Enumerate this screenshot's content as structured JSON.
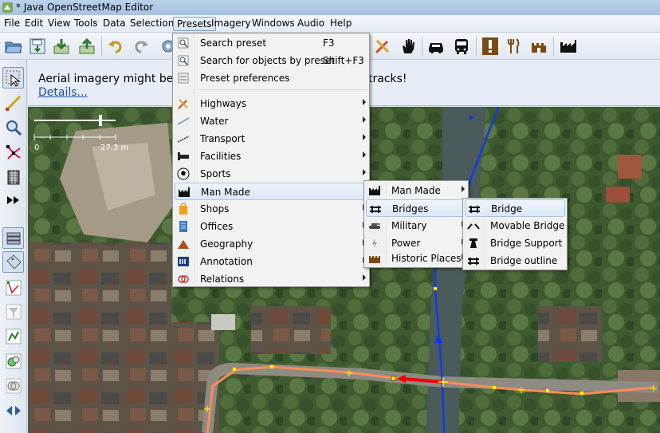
{
  "window": {
    "title": "* Java OpenStreetMap Editor",
    "icon": "josm-logo-icon"
  },
  "menubar": [
    "File",
    "Edit",
    "View",
    "Tools",
    "Data",
    "Selection",
    "Presets",
    "Imagery",
    "Windows",
    "Audio",
    "Help"
  ],
  "active_menu": "Presets",
  "toolbar": {
    "left_icons": [
      "open-folder-icon",
      "save-icon",
      "download-icon",
      "upload-icon",
      "undo-icon",
      "redo-icon",
      "preferences-icon"
    ],
    "right_icons": [
      "highway-tools-icon",
      "hand-icon",
      "car-icon",
      "bus-icon",
      "exclamation-icon",
      "restaurant-icon",
      "castle-icon",
      "factory-icon"
    ]
  },
  "left_toolbar": [
    "select-mode-icon",
    "draw-mode-icon",
    "zoom-mode-icon",
    "node-icon",
    "building-icon",
    "fast-forward-icon",
    "layers-icon",
    "tag-icon",
    "relation-icon",
    "filter-icon",
    "history-icon",
    "conflict-icon",
    "validation-icon",
    "split-icon"
  ],
  "notice": {
    "message_left": "Aerial imagery might be misa",
    "message_right": "tracks!",
    "link": "Details..."
  },
  "map": {
    "scale_start": "0",
    "scale_end": "27.3 m"
  },
  "presets_menu": {
    "top_items": [
      {
        "label": "Search preset",
        "shortcut": "F3",
        "icon": "search-preset-icon"
      },
      {
        "label": "Search for objects by preset",
        "shortcut": "Shift+F3",
        "icon": "search-objects-icon"
      },
      {
        "label": "Preset preferences",
        "shortcut": "",
        "icon": "preset-preferences-icon"
      }
    ],
    "groups": [
      {
        "label": "Highways",
        "icon": "highways-icon"
      },
      {
        "label": "Water",
        "icon": "water-icon"
      },
      {
        "label": "Transport",
        "icon": "transport-icon"
      },
      {
        "label": "Facilities",
        "icon": "facilities-icon"
      },
      {
        "label": "Sports",
        "icon": "sports-icon"
      },
      {
        "label": "Man Made",
        "icon": "man-made-icon"
      },
      {
        "label": "Shops",
        "icon": "shops-icon"
      },
      {
        "label": "Offices",
        "icon": "offices-icon"
      },
      {
        "label": "Geography",
        "icon": "geography-icon"
      },
      {
        "label": "Annotation",
        "icon": "annotation-icon"
      },
      {
        "label": "Relations",
        "icon": "relations-icon"
      }
    ],
    "highlighted": "Man Made"
  },
  "man_made_menu": {
    "items": [
      {
        "label": "Man Made",
        "icon": "factory-icon"
      },
      {
        "label": "Bridges",
        "icon": "bridge-icon"
      },
      {
        "label": "Military",
        "icon": "tank-icon"
      },
      {
        "label": "Power",
        "icon": "power-icon"
      },
      {
        "label": "Historic Places",
        "icon": "castle-icon"
      }
    ],
    "highlighted": "Bridges"
  },
  "bridges_menu": {
    "items": [
      {
        "label": "Bridge",
        "icon": "bridge-icon"
      },
      {
        "label": "Movable Bridge",
        "icon": "movable-bridge-icon"
      },
      {
        "label": "Bridge Support",
        "icon": "bridge-support-icon"
      },
      {
        "label": "Bridge outline",
        "icon": "bridge-outline-icon"
      }
    ],
    "highlighted": "Bridge"
  }
}
